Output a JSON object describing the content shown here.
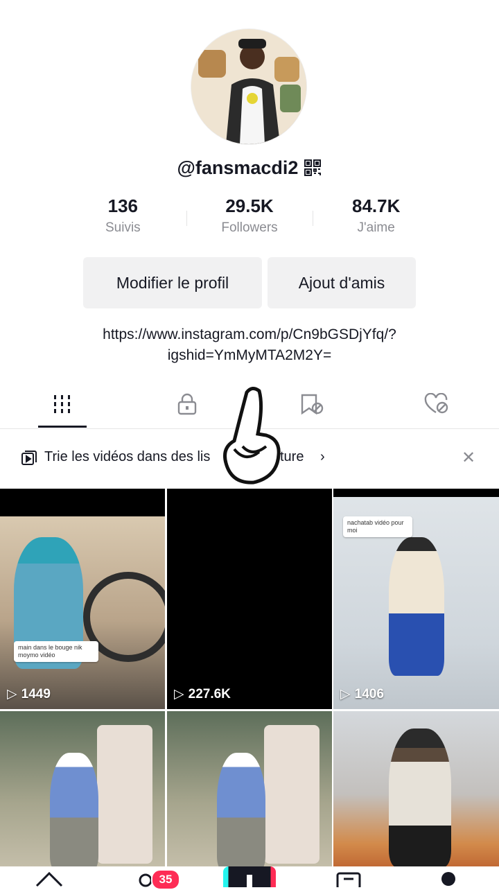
{
  "profile": {
    "username": "@fansmacdi2",
    "bio_link": "https://www.instagram.com/p/Cn9bGSDjYfq/?igshid=YmMyMTA2M2Y="
  },
  "stats": [
    {
      "value": "136",
      "label": "Suivis"
    },
    {
      "value": "29.5K",
      "label": "Followers"
    },
    {
      "value": "84.7K",
      "label": "J'aime"
    }
  ],
  "actions": {
    "edit_profile": "Modifier le profil",
    "add_friends": "Ajout d'amis"
  },
  "tabs": [
    {
      "icon": "grid-icon"
    },
    {
      "icon": "lock-icon"
    },
    {
      "icon": "repost-icon"
    },
    {
      "icon": "bookmark-hidden-icon"
    },
    {
      "icon": "heart-hidden-icon"
    }
  ],
  "banner": {
    "text": "Trie les vidéos dans des lis",
    "text_tail": "cture"
  },
  "videos": [
    {
      "views": "1449",
      "caption": "main dans le bouge nik moymo vidéo"
    },
    {
      "views": "227.6K"
    },
    {
      "views": "1406",
      "caption": "nachatab vidéo pour moi"
    },
    {
      "views": ""
    },
    {
      "views": ""
    },
    {
      "views": ""
    }
  ],
  "nav": {
    "inbox_badge": "35"
  },
  "colors": {
    "accent": "#fe2c55",
    "text": "#161823",
    "muted": "#8a8b91"
  }
}
